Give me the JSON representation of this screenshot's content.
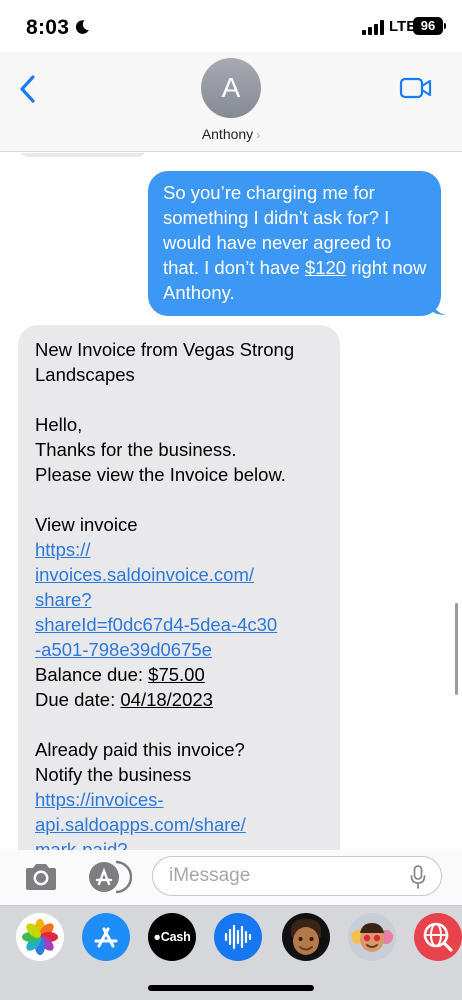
{
  "status_bar": {
    "time": "8:03",
    "network": "LTE",
    "battery": "96"
  },
  "header": {
    "avatar_initial": "A",
    "contact_name": "Anthony",
    "chevron": "›"
  },
  "messages": {
    "outgoing": {
      "text_before": "So you’re charging me for something I didn’t ask for? I would have never agreed to that. I don’t have ",
      "amount": "$120",
      "text_after": " right now Anthony."
    },
    "incoming": {
      "line1": "New Invoice from Vegas Strong Landscapes",
      "greeting": "Hello,",
      "thanks": "Thanks for the business.",
      "view_below": "Please view the Invoice below.",
      "view_invoice": "View invoice",
      "invoice_link": "https://invoices.saldoinvoice.com/share?shareId=f0dc67d4-5dea-4c30-a501-798e39d0675e",
      "balance_label": "Balance due: ",
      "balance_value": "$75.00",
      "due_label": "Due date: ",
      "due_value": "04/18/2023",
      "already_paid": "Already paid this invoice?",
      "notify": "Notify the business",
      "notify_link": "https://invoices-api.saldoapps.com/share/mark-paid?"
    }
  },
  "compose": {
    "placeholder": "iMessage"
  },
  "app_drawer": {
    "apps": [
      "photos-icon",
      "app-store-icon",
      "cash-icon",
      "audio-message-icon",
      "memoji-icon",
      "memoji-stickers-icon",
      "web-search-icon"
    ],
    "cash_label": "Cash"
  },
  "colors": {
    "outgoing_bubble": "#3d97f5",
    "incoming_bubble": "#e9e9eb",
    "link": "#2b78d9",
    "ios_blue": "#1a7cf5"
  }
}
